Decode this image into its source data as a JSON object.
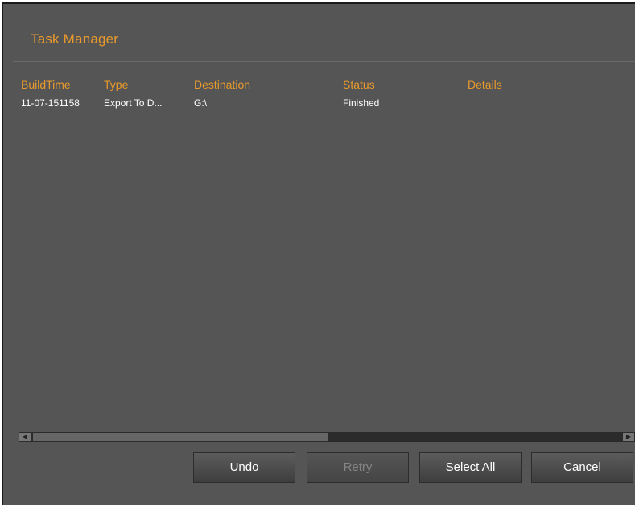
{
  "window": {
    "title": "Task Manager"
  },
  "table": {
    "columns": [
      "BuildTime",
      "Type",
      "Destination",
      "Status",
      "Details"
    ],
    "rows": [
      {
        "build_time": "11-07-151158",
        "type": "Export To D...",
        "destination": "G:\\",
        "status": "Finished",
        "details": ""
      }
    ]
  },
  "buttons": {
    "undo": "Undo",
    "retry": "Retry",
    "select_all": "Select All",
    "cancel": "Cancel"
  },
  "colors": {
    "accent": "#e89a2c",
    "background": "#555555",
    "text": "#ffffff",
    "disabled_text": "#858585"
  },
  "icons": {
    "scroll_left": "left-arrow-icon",
    "scroll_right": "right-arrow-icon"
  }
}
